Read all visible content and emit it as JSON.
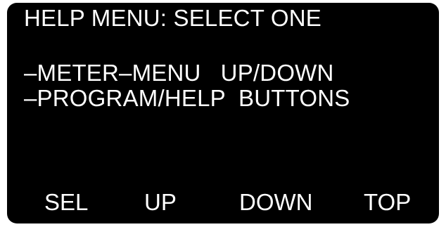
{
  "screen": {
    "title": "HELP MENU: SELECT ONE",
    "lines": [
      "–METER–MENU   UP/DOWN",
      "–PROGRAM/HELP  BUTTONS"
    ]
  },
  "softkeys": {
    "sel": "SEL",
    "up": "UP",
    "down": "DOWN",
    "top": "TOP"
  },
  "colors": {
    "background": "#000000",
    "text": "#ffffff"
  }
}
